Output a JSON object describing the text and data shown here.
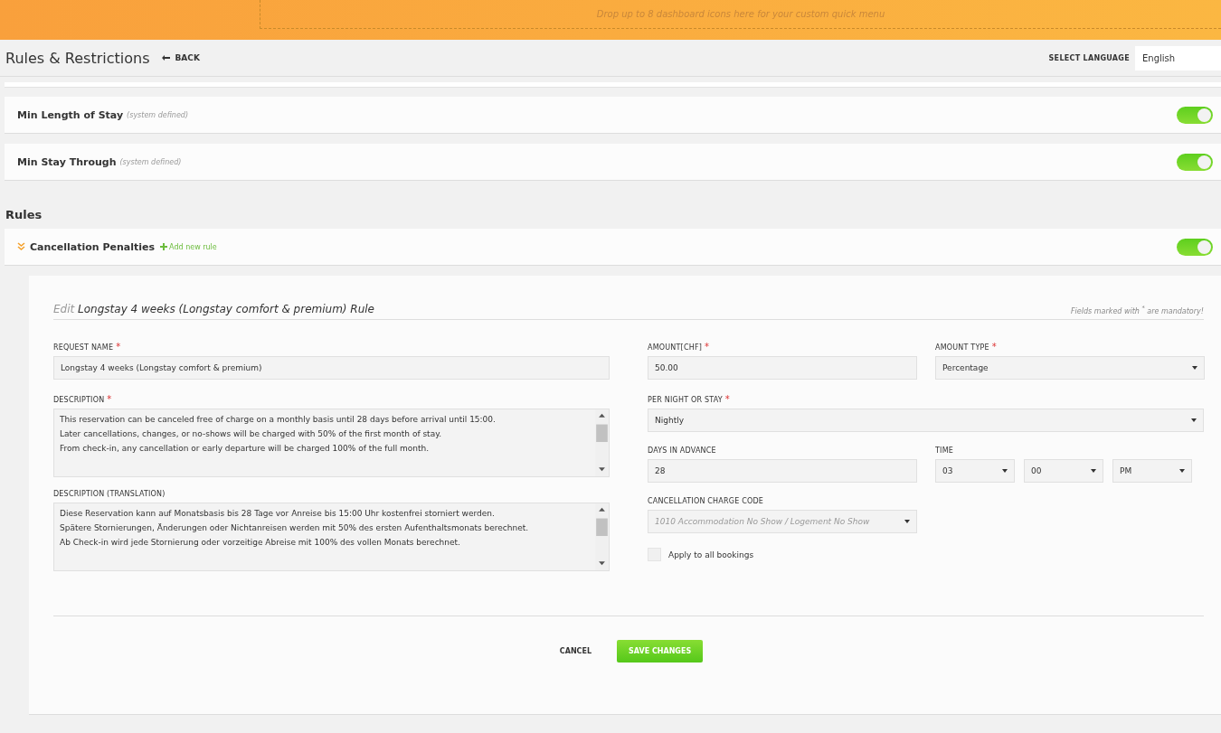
{
  "quick_menu": {
    "placeholder": "Drop up to 8 dashboard icons here for your custom quick menu"
  },
  "header": {
    "title": "Rules & Restrictions",
    "back": "BACK",
    "language_label": "SELECT LANGUAGE",
    "language": "English"
  },
  "restrictions": [
    {
      "name": "Min Length of Stay",
      "note": "(system defined)",
      "on": true
    },
    {
      "name": "Min Stay Through",
      "note": "(system defined)",
      "on": true
    }
  ],
  "rules_heading": "Rules",
  "required_mark": "*",
  "rule_group": {
    "name": "Cancellation Penalties",
    "add": "Add new rule",
    "expanded": true,
    "on": true
  },
  "editor": {
    "prefix": "Edit",
    "title": "Longstay 4 weeks (Longstay comfort & premium) Rule",
    "mandatory_note": "Fields marked with $^{*}$ are mandatory!",
    "request_name": {
      "label": "REQUEST NAME",
      "required": true,
      "value": "Longstay 4 weeks (Longstay comfort & premium)"
    },
    "description": {
      "label": "DESCRIPTION",
      "required": true,
      "lines": [
        "This reservation can be canceled free of charge on a monthly basis until 28 days before arrival until 15:00.",
        "Later cancellations, changes, or no-shows will be charged with 50% of the first month of stay.",
        "From check-in, any cancellation or early departure will be charged 100% of the full month."
      ]
    },
    "translation": {
      "label": "DESCRIPTION (TRANSLATION)",
      "required": false,
      "lines": [
        "Diese Reservation kann auf Monatsbasis bis 28 Tage vor Anreise bis 15:00 Uhr kostenfrei storniert werden.",
        "Spätere Stornierungen, Änderungen oder Nichtanreisen werden mit 50% des ersten Aufenthaltsmonats berechnet.",
        "Ab Check-in wird jede Stornierung oder vorzeitige Abreise mit 100% des vollen Monats berechnet."
      ]
    },
    "amount": {
      "label": "AMOUNT[CHF]",
      "required": true,
      "value": "50.00"
    },
    "amount_type": {
      "label": "AMOUNT TYPE",
      "required": true,
      "value": "Percentage"
    },
    "per_night": {
      "label": "PER NIGHT OR STAY",
      "required": true,
      "value": "Nightly"
    },
    "days": {
      "label": "DAYS IN ADVANCE",
      "required": false,
      "value": "28"
    },
    "time": {
      "label": "TIME",
      "hour": "03",
      "minute": "00",
      "ampm": "PM"
    },
    "charge_code": {
      "label": "CANCELLATION CHARGE CODE",
      "placeholder": "1010 Accommodation No Show / Logement No Show"
    },
    "apply_all": {
      "label": "Apply to all bookings",
      "checked": false
    },
    "cancel": "CANCEL",
    "save": "SAVE CHANGES"
  }
}
